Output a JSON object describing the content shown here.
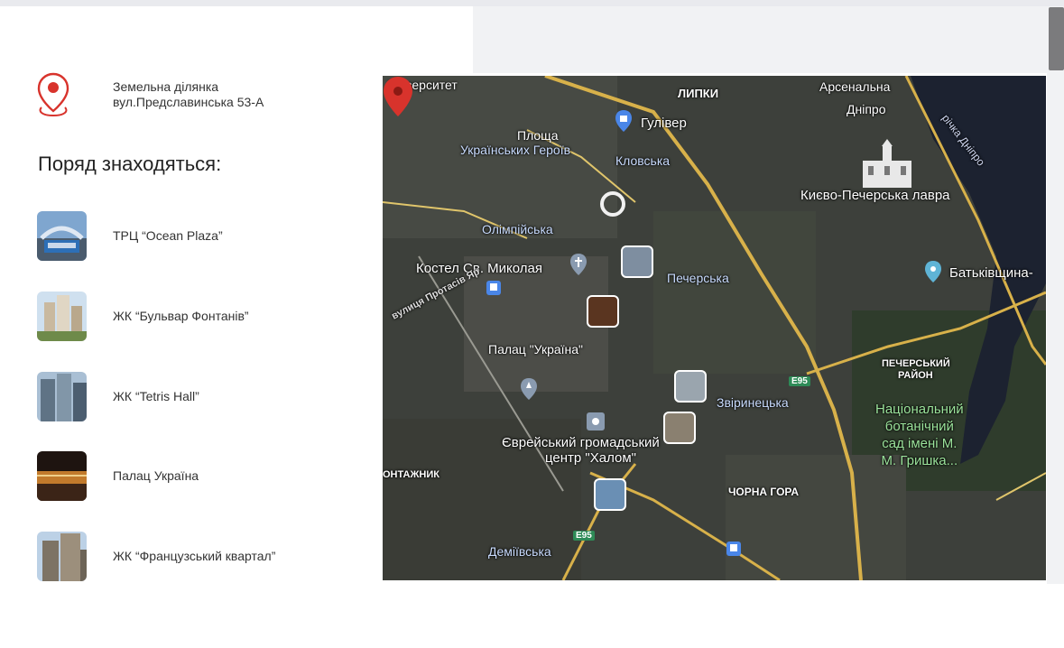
{
  "address": {
    "line1": "Земельна ділянка",
    "line2": "вул.Предславинська 53-А"
  },
  "nearby_title": "Поряд знаходяться:",
  "places": [
    {
      "label": "ТРЦ “Ocean Plaza”"
    },
    {
      "label": "ЖК “Бульвар Фонтанів”"
    },
    {
      "label": "ЖК “Tetris Hall”"
    },
    {
      "label": "Палац Україна"
    },
    {
      "label": "ЖК “Французський квартал”"
    }
  ],
  "map": {
    "labels": {
      "universytet": "Університет",
      "lypky": "ЛИПКИ",
      "arsenalna": "Арсенальна",
      "dnipro": "Дніпро",
      "river": "річка Дніпро",
      "hulliver": "Гулівер",
      "ploshcha1": "Площа",
      "ploshcha2": "Українських Героїв",
      "klovska": "Кловська",
      "lavra": "Києво-Печерська лавра",
      "olimpiiska": "Олімпійська",
      "kostel": "Костел Св. Миколая",
      "pecherska": "Печерська",
      "batkivshchyna": "Батьківщина-",
      "protasiv": "вулиця Протасів Яр",
      "palats": "Палац \"Україна\"",
      "pechersk_district1": "ПЕЧЕРСЬКИЙ",
      "pechersk_district2": "РАЙОН",
      "e95a": "E95",
      "zvirynetska": "Звіринецька",
      "botanic1": "Національний",
      "botanic2": "ботанічний",
      "botanic3": "сад імені М.",
      "botanic4": "М. Гришка...",
      "jewish1": "Єврейський громадський",
      "jewish2": "центр \"Халом\"",
      "montazhnyk": "ОНТАЖНИК",
      "chorna_hora": "ЧОРНА ГОРА",
      "e95b": "E95",
      "demiivska": "Деміївська"
    }
  },
  "colors": {
    "accent_red": "#d8332c",
    "metro_green": "#2e9e4b",
    "poi_blue": "#4a86e8",
    "map_road": "#d8b14a"
  }
}
